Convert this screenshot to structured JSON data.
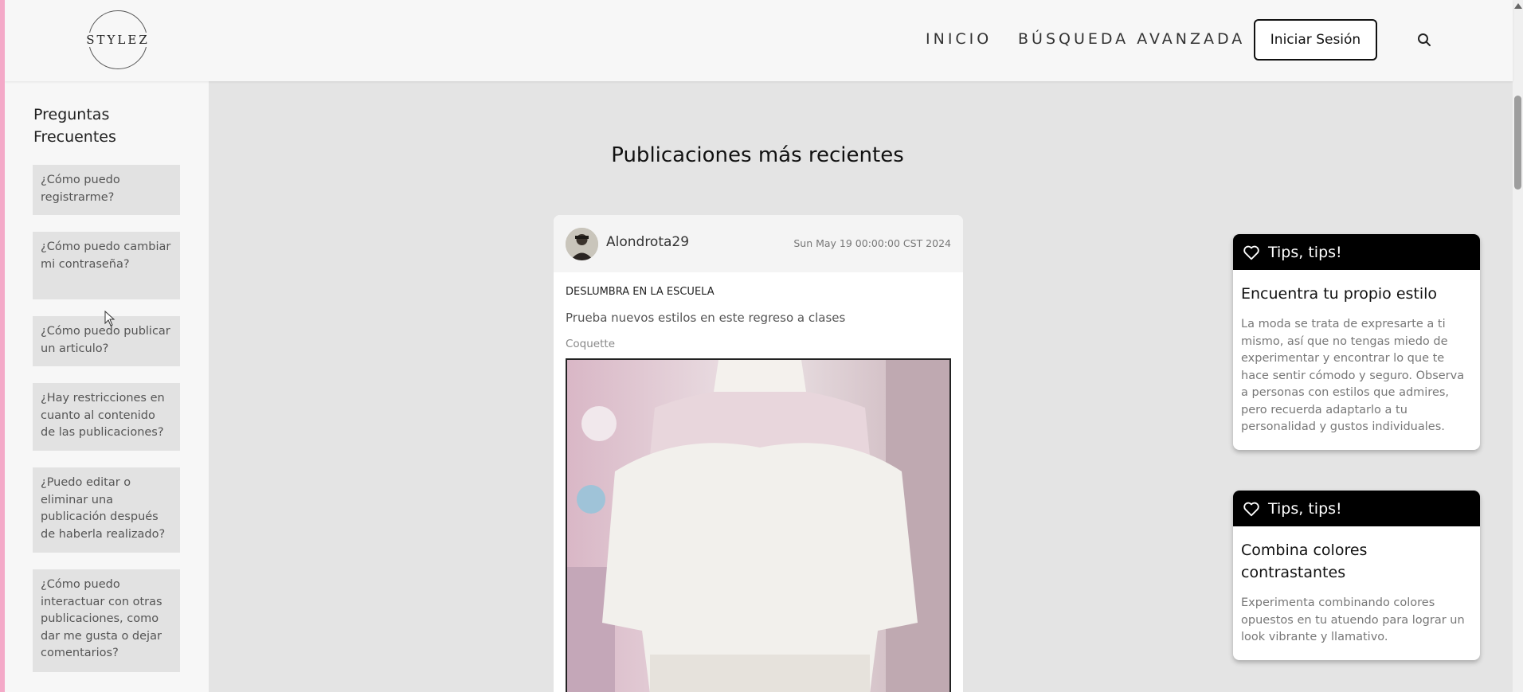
{
  "header": {
    "logo_text": "STYLEZ",
    "nav": {
      "inicio": "INICIO",
      "busqueda": "BÚSQUEDA AVANZADA"
    },
    "login_label": "Iniciar Sesión",
    "search_icon": "search-icon"
  },
  "sidebar": {
    "title": "Preguntas Frecuentes",
    "items": [
      "¿Cómo puedo registrarme?",
      "¿Cómo puedo cambiar mi contraseña?",
      "¿Cómo puedo publicar un articulo?",
      "¿Hay restricciones en cuanto al contenido de las publicaciones?",
      "¿Puedo editar o eliminar una publicación después de haberla realizado?",
      "¿Cómo puedo interactuar con otras publicaciones, como dar me gusta o dejar comentarios?"
    ]
  },
  "main": {
    "title": "Publicaciones más recientes",
    "post": {
      "user": "Alondrota29",
      "date": "Sun May 19 00:00:00 CST 2024",
      "title": "DESLUMBRA EN LA ESCUELA",
      "description": "Prueba nuevos estilos en este regreso a clases",
      "tag": "Coquette"
    }
  },
  "tips": [
    {
      "header": "Tips, tips!",
      "icon": "heart-icon",
      "title": "Encuentra tu propio estilo",
      "text": "La moda se trata de expresarte a ti mismo, así que no tengas miedo de experimentar y encontrar lo que te hace sentir cómodo y seguro. Observa a personas con estilos que admires, pero recuerda adaptarlo a tu personalidad y gustos individuales."
    },
    {
      "header": "Tips, tips!",
      "icon": "heart-icon",
      "title": "Combina colores contrastantes",
      "text": "Experimenta combinando colores opuestos en tu atuendo para lograr un look vibrante y llamativo."
    }
  ],
  "colors": {
    "accent_strip": "#f4a9c8",
    "tip_header": "#000000",
    "page_bg": "#e4e4e4"
  }
}
